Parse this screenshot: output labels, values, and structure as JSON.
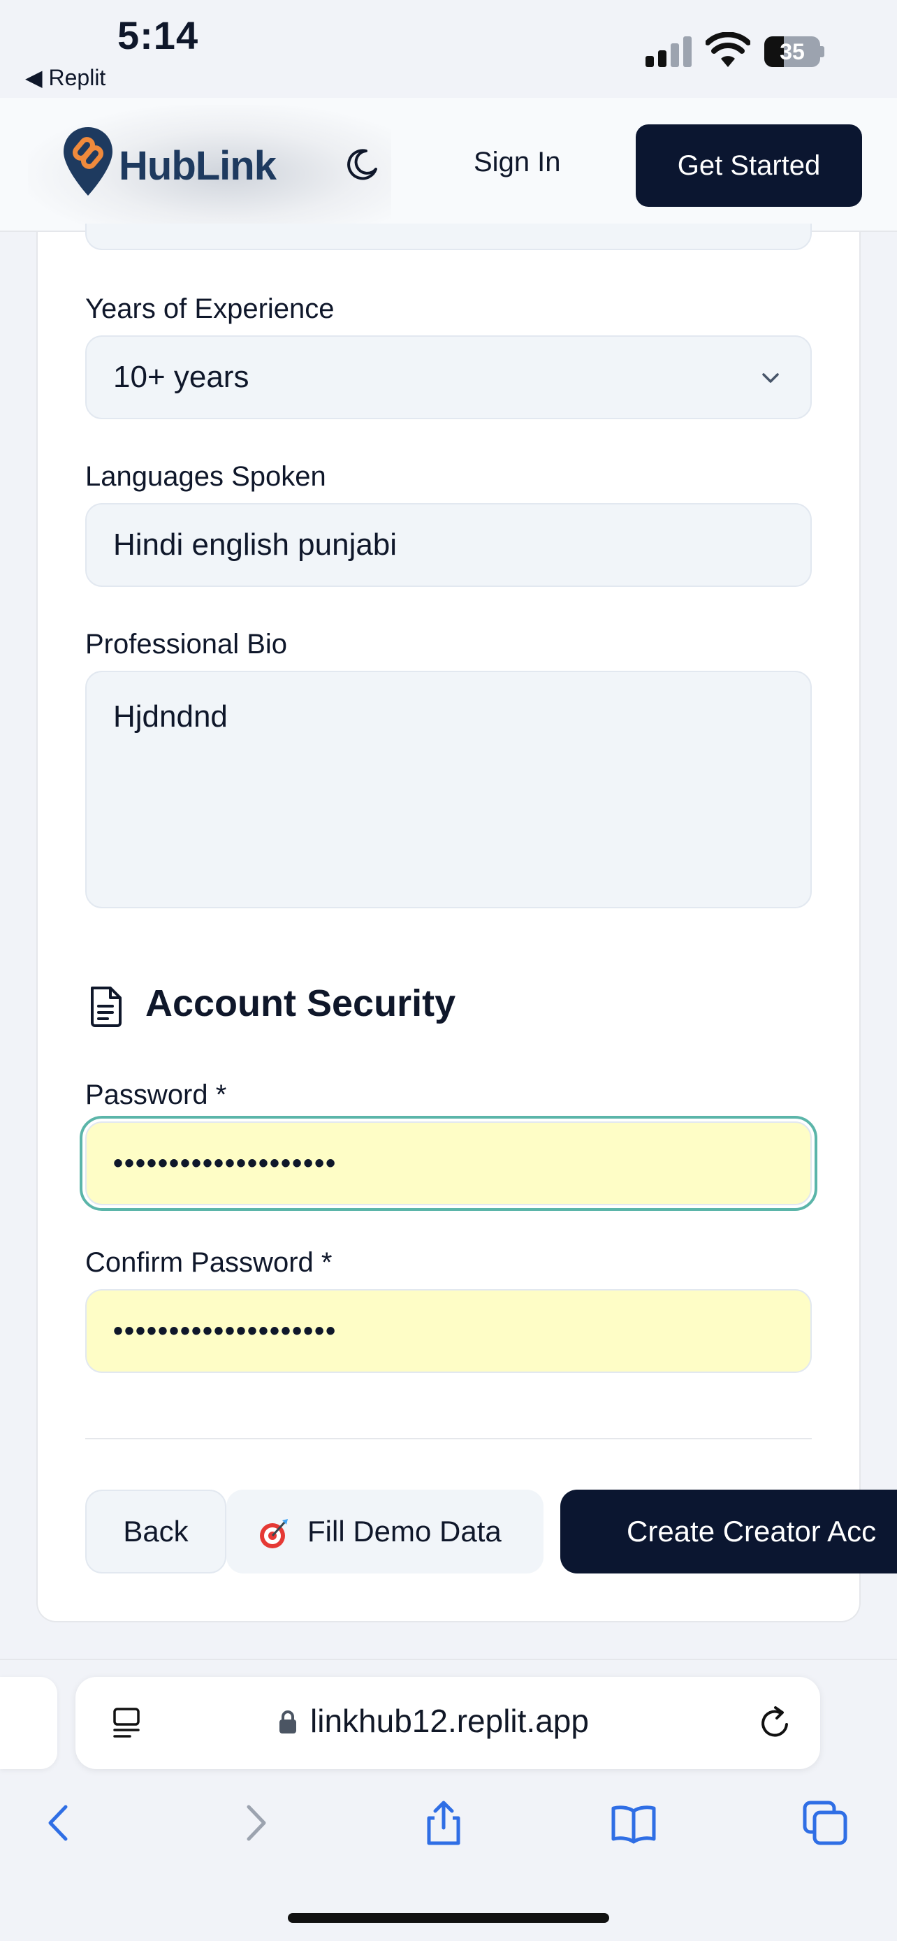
{
  "status_bar": {
    "time": "5:14",
    "back_app": "◀ Replit",
    "battery": "35",
    "battery_level": 0.35
  },
  "header": {
    "brand": "HubLink",
    "signin": "Sign In",
    "cta": "Get Started",
    "accent": "#0b1630"
  },
  "form": {
    "experience": {
      "label": "Years of Experience",
      "value": "10+ years"
    },
    "languages": {
      "label": "Languages Spoken",
      "value": "Hindi english punjabi"
    },
    "bio": {
      "label": "Professional Bio",
      "value": "Hjdndnd"
    },
    "security_title": "Account Security",
    "password": {
      "label": "Password *",
      "value": "••••••••••••••••••••"
    },
    "confirm": {
      "label": "Confirm Password *",
      "value": "••••••••••••••••••••"
    }
  },
  "actions": {
    "back": "Back",
    "demo": "Fill Demo Data",
    "create": "Create Creator Acc"
  },
  "browser": {
    "url": "linkhub12.replit.app"
  },
  "colors": {
    "focus_ring": "#5bb5a9",
    "autofill": "#fefdc6",
    "field_bg": "#f1f5f9"
  }
}
